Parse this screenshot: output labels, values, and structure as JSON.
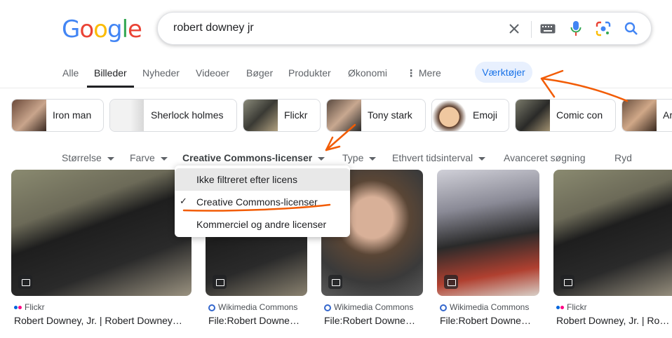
{
  "logo": {
    "letters": [
      "G",
      "o",
      "o",
      "g",
      "l",
      "e"
    ],
    "colors": [
      "#4285f4",
      "#ea4335",
      "#fbbc05",
      "#4285f4",
      "#34a853",
      "#ea4335"
    ]
  },
  "search": {
    "query": "robert downey jr",
    "icons": [
      "close-icon",
      "keyboard-icon",
      "mic-icon",
      "lens-icon",
      "search-icon"
    ]
  },
  "tabs": [
    {
      "label": "Alle"
    },
    {
      "label": "Billeder"
    },
    {
      "label": "Nyheder"
    },
    {
      "label": "Videoer"
    },
    {
      "label": "Bøger"
    },
    {
      "label": "Produkter"
    },
    {
      "label": "Økonomi"
    },
    {
      "label": "Mere"
    }
  ],
  "active_tab": "Billeder",
  "tools_button": "Værktøjer",
  "chips": [
    {
      "label": "Iron man"
    },
    {
      "label": "Sherlock holmes"
    },
    {
      "label": "Flickr"
    },
    {
      "label": "Tony stark"
    },
    {
      "label": "Emoji"
    },
    {
      "label": "Comic con"
    },
    {
      "label": "Ar"
    }
  ],
  "filters": {
    "size": "Størrelse",
    "color": "Farve",
    "license": "Creative Commons-licenser",
    "type": "Type",
    "time": "Ethvert tidsinterval",
    "advanced": "Avanceret søgning",
    "clear": "Ryd"
  },
  "license_dropdown": {
    "options": [
      {
        "label": "Ikke filtreret efter licens",
        "checked": false
      },
      {
        "label": "Creative Commons-licenser",
        "checked": true
      },
      {
        "label": "Kommerciel og andre licenser",
        "checked": false
      }
    ]
  },
  "results": [
    {
      "source": "Flickr",
      "title": "Robert Downey, Jr. | Robert Downey…",
      "source_type": "flickr"
    },
    {
      "source": "Wikimedia Commons",
      "title": "File:Robert Downe…",
      "source_type": "wiki"
    },
    {
      "source": "Wikimedia Commons",
      "title": "File:Robert Downe…",
      "source_type": "wiki"
    },
    {
      "source": "Wikimedia Commons",
      "title": "File:Robert Downe…",
      "source_type": "wiki"
    },
    {
      "source": "Flickr",
      "title": "Robert Downey, Jr. | Robert Downe",
      "source_type": "flickr"
    }
  ],
  "colors": {
    "accent": "#1a73e8",
    "annotation": "#f25c05",
    "tools_bg": "#e8f0fe"
  }
}
